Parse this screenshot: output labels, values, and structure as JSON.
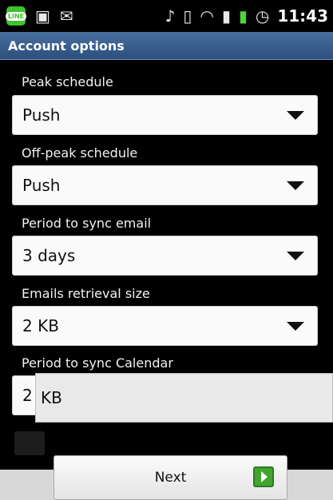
{
  "status_bar": {
    "time": "11:43",
    "icons": [
      "line-app-icon",
      "briefcase-icon",
      "mail-icon",
      "mute-icon",
      "vibrate-icon",
      "wifi-icon",
      "signal-icon",
      "battery-icon",
      "alarm-icon"
    ],
    "line_label": "LINE"
  },
  "header": {
    "title": "Account options"
  },
  "settings": [
    {
      "label": "Peak schedule",
      "value": "Push"
    },
    {
      "label": "Off-peak schedule",
      "value": "Push"
    },
    {
      "label": "Period to sync email",
      "value": "3 days"
    },
    {
      "label": "Emails retrieval size",
      "value": "2 KB"
    },
    {
      "label": "Period to sync Calendar",
      "value": "2"
    }
  ],
  "popup": {
    "text": "KB"
  },
  "footer": {
    "next_label": "Next"
  },
  "colors": {
    "title_bar": "#2c4f7d",
    "next_icon": "#41a52f",
    "line_app": "#3ec230"
  }
}
